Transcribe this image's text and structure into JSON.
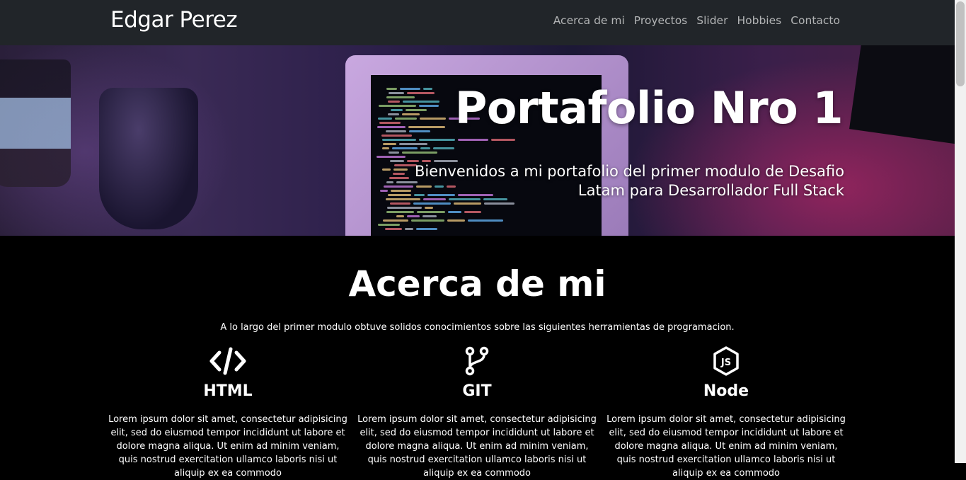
{
  "navbar": {
    "brand": "Edgar Perez",
    "links": [
      "Acerca de mi",
      "Proyectos",
      "Slider",
      "Hobbies",
      "Contacto"
    ]
  },
  "hero": {
    "title": "Portafolio Nro 1",
    "subtitle": "Bienvenidos a mi portafolio del primer modulo de Desafio Latam para Desarrollador Full Stack"
  },
  "about": {
    "title": "Acerca de mi",
    "description": "A lo largo del primer modulo obtuve solidos conocimientos sobre las siguientes herramientas de programacion.",
    "items": [
      {
        "icon": "code-icon",
        "title": "HTML",
        "text": "Lorem ipsum dolor sit amet, consectetur adipisicing elit, sed do eiusmod tempor incididunt ut labore et dolore magna aliqua. Ut enim ad minim veniam, quis nostrud exercitation ullamco laboris nisi ut aliquip ex ea commodo"
      },
      {
        "icon": "git-branch-icon",
        "title": "GIT",
        "text": "Lorem ipsum dolor sit amet, consectetur adipisicing elit, sed do eiusmod tempor incididunt ut labore et dolore magna aliqua. Ut enim ad minim veniam, quis nostrud exercitation ullamco laboris nisi ut aliquip ex ea commodo"
      },
      {
        "icon": "nodejs-icon",
        "title": "Node",
        "text": "Lorem ipsum dolor sit amet, consectetur adipisicing elit, sed do eiusmod tempor incididunt ut labore et dolore magna aliqua. Ut enim ad minim veniam, quis nostrud exercitation ullamco laboris nisi ut aliquip ex ea commodo"
      }
    ]
  },
  "colors": {
    "navbar_bg": "#212529",
    "page_bg": "#000000",
    "nav_link": "rgba(255,255,255,0.65)"
  }
}
